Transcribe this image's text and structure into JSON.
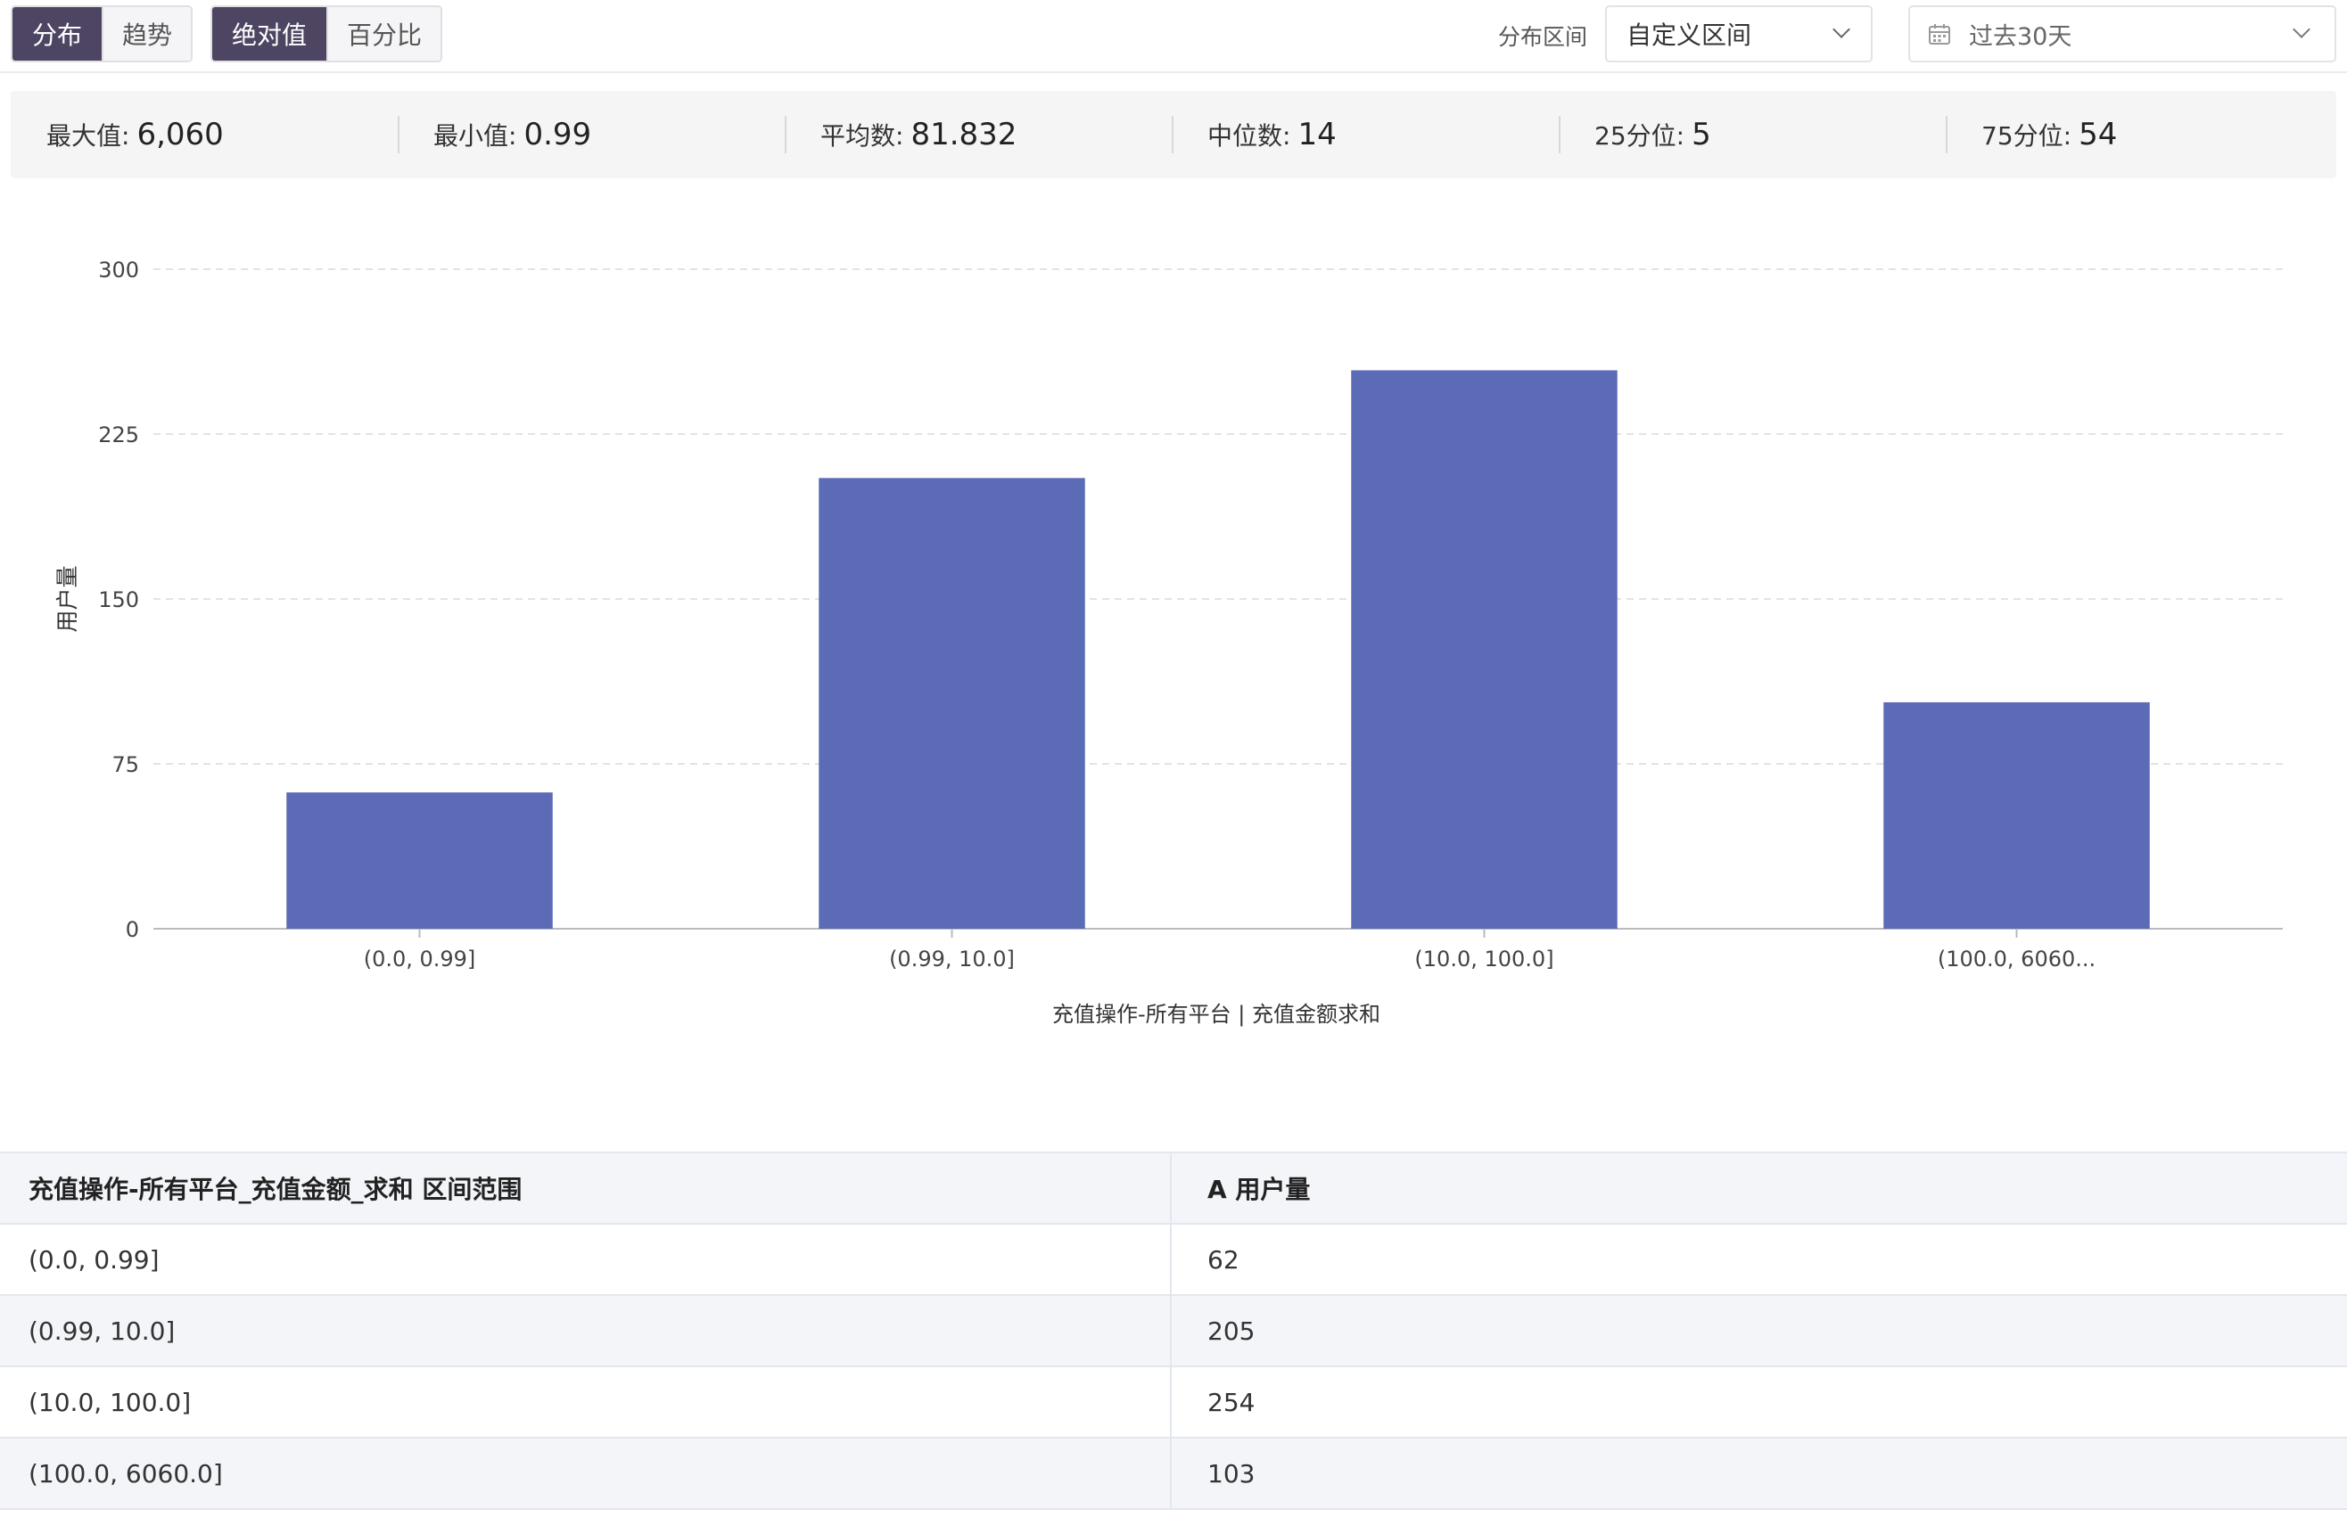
{
  "toolbar": {
    "view_tabs": [
      {
        "label": "分布",
        "active": true
      },
      {
        "label": "趋势",
        "active": false
      }
    ],
    "value_tabs": [
      {
        "label": "绝对值",
        "active": true
      },
      {
        "label": "百分比",
        "active": false
      }
    ],
    "range_label": "分布区间",
    "range_select": "自定义区间",
    "date_select": "过去30天"
  },
  "stats": [
    {
      "label": "最大值:",
      "value": "6,060"
    },
    {
      "label": "最小值:",
      "value": "0.99"
    },
    {
      "label": "平均数:",
      "value": "81.832"
    },
    {
      "label": "中位数:",
      "value": "14"
    },
    {
      "label": "25分位:",
      "value": "5"
    },
    {
      "label": "75分位:",
      "value": "54"
    }
  ],
  "colors": {
    "bar": "#5c6bb5",
    "active_tab": "#4e4563",
    "grid": "#e3e3e3",
    "axis": "#bbbbbb"
  },
  "chart_data": {
    "type": "bar",
    "categories": [
      "(0.0, 0.99]",
      "(0.99, 10.0]",
      "(10.0, 100.0]",
      "(100.0, 6060..."
    ],
    "values": [
      62,
      205,
      254,
      103
    ],
    "xlabel": "充值操作-所有平台 | 充值金额求和",
    "ylabel": "用户量",
    "ylim": [
      0,
      300
    ],
    "yticks": [
      "300",
      "225",
      "150",
      "75",
      "0"
    ],
    "grid": true
  },
  "table": {
    "headers": [
      "充值操作-所有平台_充值金额_求和 区间范围",
      "A 用户量"
    ],
    "rows": [
      [
        "(0.0, 0.99]",
        "62"
      ],
      [
        "(0.99, 10.0]",
        "205"
      ],
      [
        "(10.0, 100.0]",
        "254"
      ],
      [
        "(100.0, 6060.0]",
        "103"
      ]
    ]
  }
}
